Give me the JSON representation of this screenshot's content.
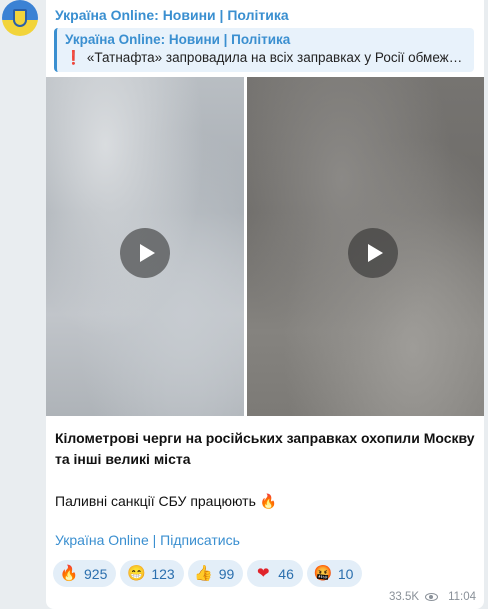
{
  "channel": {
    "name": "Україна Online: Новини | Політика"
  },
  "reply": {
    "title": "Україна Online: Новини | Політика",
    "marker": "❗",
    "text": "«Татнафта» запровадила на всіх заправках у Росії обмеж…"
  },
  "message": {
    "paragraph1": "Кілометрові черги на російських заправках охопили Москву та інші великі міста",
    "paragraph2": "Паливні санкції СБУ працюють 🔥",
    "signature": "Україна Online | Підписатись"
  },
  "media": {
    "videos": [
      {
        "icon": "play-icon"
      },
      {
        "icon": "play-icon"
      }
    ]
  },
  "reactions": [
    {
      "emoji": "🔥",
      "icon": "fire-icon",
      "count": "925"
    },
    {
      "emoji": "😁",
      "icon": "grin-icon",
      "count": "123"
    },
    {
      "emoji": "👍",
      "icon": "thumbs-up-icon",
      "count": "99"
    },
    {
      "emoji": "❤",
      "icon": "heart-icon",
      "count": "46"
    },
    {
      "emoji": "🤬",
      "icon": "angry-face-icon",
      "count": "10"
    }
  ],
  "meta": {
    "views": "33.5K",
    "time": "11:04"
  },
  "colors": {
    "accent": "#3a8fd0",
    "background": "#e9edf0",
    "reaction_bg": "#e3eef8"
  }
}
